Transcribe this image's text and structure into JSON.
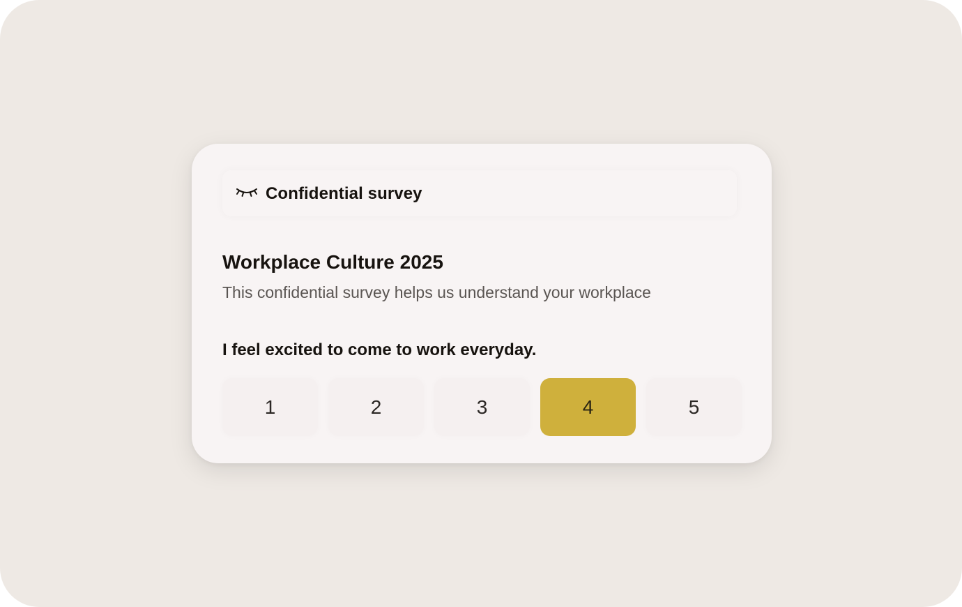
{
  "badge": {
    "icon": "closed-eye-icon",
    "label": "Confidential survey"
  },
  "survey": {
    "title": "Workplace Culture 2025",
    "description": "This confidential survey helps us understand your workplace"
  },
  "question": {
    "text": "I feel excited to come to work everyday.",
    "options": [
      "1",
      "2",
      "3",
      "4",
      "5"
    ],
    "selected": "4"
  },
  "colors": {
    "background": "#eee9e4",
    "card": "#f8f4f4",
    "accent": "#cfb03c",
    "text": "#17130f",
    "muted_text": "#5a5552"
  }
}
